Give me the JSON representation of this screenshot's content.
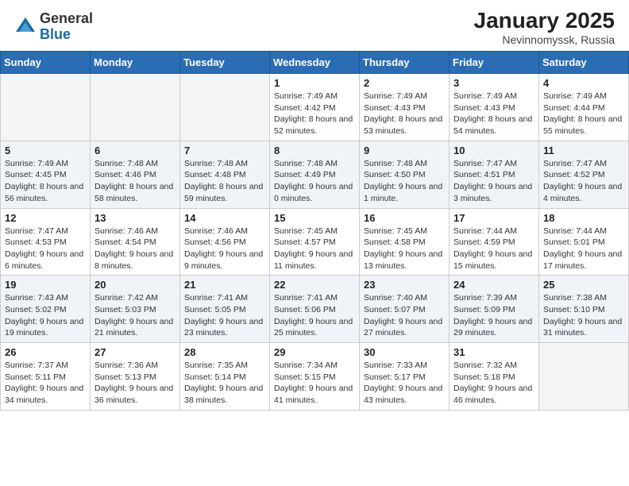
{
  "header": {
    "logo_general": "General",
    "logo_blue": "Blue",
    "month_year": "January 2025",
    "location": "Nevinnomyssk, Russia"
  },
  "weekdays": [
    "Sunday",
    "Monday",
    "Tuesday",
    "Wednesday",
    "Thursday",
    "Friday",
    "Saturday"
  ],
  "weeks": [
    [
      {
        "day": "",
        "info": ""
      },
      {
        "day": "",
        "info": ""
      },
      {
        "day": "",
        "info": ""
      },
      {
        "day": "1",
        "info": "Sunrise: 7:49 AM\nSunset: 4:42 PM\nDaylight: 8 hours and 52 minutes."
      },
      {
        "day": "2",
        "info": "Sunrise: 7:49 AM\nSunset: 4:43 PM\nDaylight: 8 hours and 53 minutes."
      },
      {
        "day": "3",
        "info": "Sunrise: 7:49 AM\nSunset: 4:43 PM\nDaylight: 8 hours and 54 minutes."
      },
      {
        "day": "4",
        "info": "Sunrise: 7:49 AM\nSunset: 4:44 PM\nDaylight: 8 hours and 55 minutes."
      }
    ],
    [
      {
        "day": "5",
        "info": "Sunrise: 7:49 AM\nSunset: 4:45 PM\nDaylight: 8 hours and 56 minutes."
      },
      {
        "day": "6",
        "info": "Sunrise: 7:48 AM\nSunset: 4:46 PM\nDaylight: 8 hours and 58 minutes."
      },
      {
        "day": "7",
        "info": "Sunrise: 7:48 AM\nSunset: 4:48 PM\nDaylight: 8 hours and 59 minutes."
      },
      {
        "day": "8",
        "info": "Sunrise: 7:48 AM\nSunset: 4:49 PM\nDaylight: 9 hours and 0 minutes."
      },
      {
        "day": "9",
        "info": "Sunrise: 7:48 AM\nSunset: 4:50 PM\nDaylight: 9 hours and 1 minute."
      },
      {
        "day": "10",
        "info": "Sunrise: 7:47 AM\nSunset: 4:51 PM\nDaylight: 9 hours and 3 minutes."
      },
      {
        "day": "11",
        "info": "Sunrise: 7:47 AM\nSunset: 4:52 PM\nDaylight: 9 hours and 4 minutes."
      }
    ],
    [
      {
        "day": "12",
        "info": "Sunrise: 7:47 AM\nSunset: 4:53 PM\nDaylight: 9 hours and 6 minutes."
      },
      {
        "day": "13",
        "info": "Sunrise: 7:46 AM\nSunset: 4:54 PM\nDaylight: 9 hours and 8 minutes."
      },
      {
        "day": "14",
        "info": "Sunrise: 7:46 AM\nSunset: 4:56 PM\nDaylight: 9 hours and 9 minutes."
      },
      {
        "day": "15",
        "info": "Sunrise: 7:45 AM\nSunset: 4:57 PM\nDaylight: 9 hours and 11 minutes."
      },
      {
        "day": "16",
        "info": "Sunrise: 7:45 AM\nSunset: 4:58 PM\nDaylight: 9 hours and 13 minutes."
      },
      {
        "day": "17",
        "info": "Sunrise: 7:44 AM\nSunset: 4:59 PM\nDaylight: 9 hours and 15 minutes."
      },
      {
        "day": "18",
        "info": "Sunrise: 7:44 AM\nSunset: 5:01 PM\nDaylight: 9 hours and 17 minutes."
      }
    ],
    [
      {
        "day": "19",
        "info": "Sunrise: 7:43 AM\nSunset: 5:02 PM\nDaylight: 9 hours and 19 minutes."
      },
      {
        "day": "20",
        "info": "Sunrise: 7:42 AM\nSunset: 5:03 PM\nDaylight: 9 hours and 21 minutes."
      },
      {
        "day": "21",
        "info": "Sunrise: 7:41 AM\nSunset: 5:05 PM\nDaylight: 9 hours and 23 minutes."
      },
      {
        "day": "22",
        "info": "Sunrise: 7:41 AM\nSunset: 5:06 PM\nDaylight: 9 hours and 25 minutes."
      },
      {
        "day": "23",
        "info": "Sunrise: 7:40 AM\nSunset: 5:07 PM\nDaylight: 9 hours and 27 minutes."
      },
      {
        "day": "24",
        "info": "Sunrise: 7:39 AM\nSunset: 5:09 PM\nDaylight: 9 hours and 29 minutes."
      },
      {
        "day": "25",
        "info": "Sunrise: 7:38 AM\nSunset: 5:10 PM\nDaylight: 9 hours and 31 minutes."
      }
    ],
    [
      {
        "day": "26",
        "info": "Sunrise: 7:37 AM\nSunset: 5:11 PM\nDaylight: 9 hours and 34 minutes."
      },
      {
        "day": "27",
        "info": "Sunrise: 7:36 AM\nSunset: 5:13 PM\nDaylight: 9 hours and 36 minutes."
      },
      {
        "day": "28",
        "info": "Sunrise: 7:35 AM\nSunset: 5:14 PM\nDaylight: 9 hours and 38 minutes."
      },
      {
        "day": "29",
        "info": "Sunrise: 7:34 AM\nSunset: 5:15 PM\nDaylight: 9 hours and 41 minutes."
      },
      {
        "day": "30",
        "info": "Sunrise: 7:33 AM\nSunset: 5:17 PM\nDaylight: 9 hours and 43 minutes."
      },
      {
        "day": "31",
        "info": "Sunrise: 7:32 AM\nSunset: 5:18 PM\nDaylight: 9 hours and 46 minutes."
      },
      {
        "day": "",
        "info": ""
      }
    ]
  ]
}
